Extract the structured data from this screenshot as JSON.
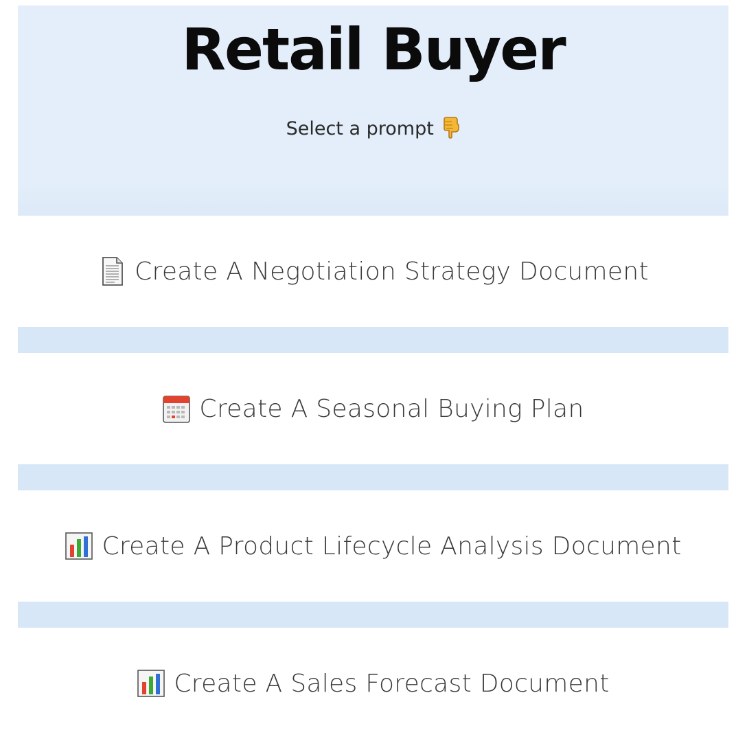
{
  "header": {
    "title": "Retail Buyer",
    "subtitle": "Select a prompt",
    "subtitle_icon": "backhand-index-pointing-down-icon"
  },
  "prompts": [
    {
      "label": "Create A Negotiation Strategy Document",
      "icon": "page-document-icon"
    },
    {
      "label": "Create A Seasonal Buying Plan",
      "icon": "calendar-icon"
    },
    {
      "label": "Create A Product Lifecycle Analysis Document",
      "icon": "bar-chart-icon"
    },
    {
      "label": "Create A Sales Forecast Document",
      "icon": "bar-chart-icon"
    }
  ],
  "colors": {
    "header_bg": "#e3eefa",
    "separator": "#d8e7f7",
    "card_bg": "#ffffff",
    "title": "#0b0b0b",
    "label": "#3a3a3a"
  }
}
